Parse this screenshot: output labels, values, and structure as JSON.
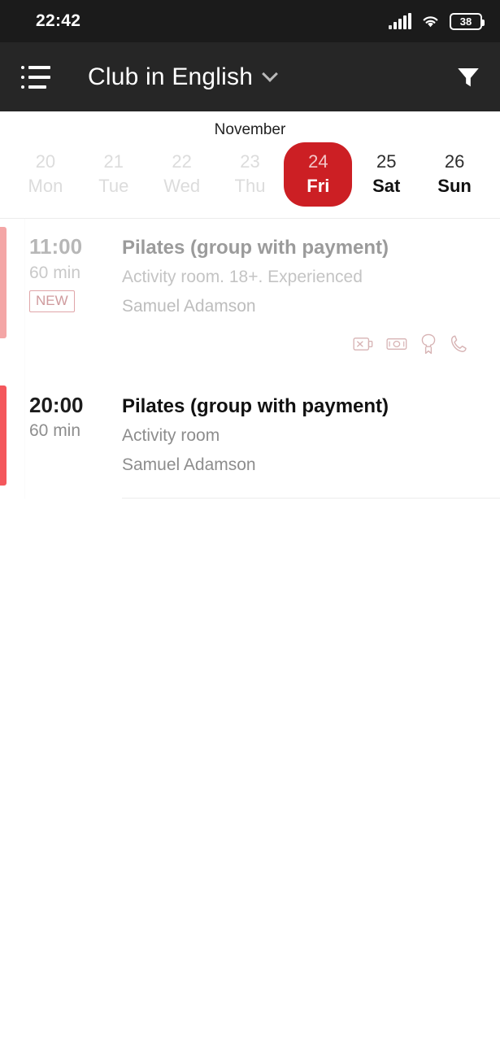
{
  "statusbar": {
    "time": "22:42",
    "signal_icon": "cellular-signal-icon",
    "wifi_icon": "wifi-icon",
    "battery_icon": "battery-icon",
    "battery_level": "38"
  },
  "appbar": {
    "menu_icon": "list-menu-icon",
    "title": "Club in English",
    "dropdown_icon": "chevron-down-icon",
    "filter_icon": "filter-funnel-icon"
  },
  "calendar": {
    "month": "November",
    "days": [
      {
        "num": "20",
        "dow": "Mon",
        "state": "past"
      },
      {
        "num": "21",
        "dow": "Tue",
        "state": "past"
      },
      {
        "num": "22",
        "dow": "Wed",
        "state": "past"
      },
      {
        "num": "23",
        "dow": "Thu",
        "state": "past"
      },
      {
        "num": "24",
        "dow": "Fri",
        "state": "selected"
      },
      {
        "num": "25",
        "dow": "Sat",
        "state": "normal"
      },
      {
        "num": "26",
        "dow": "Sun",
        "state": "normal"
      }
    ],
    "selected_color": "#cc1f24"
  },
  "events": [
    {
      "time": "11:00",
      "duration": "60 min",
      "badge": "NEW",
      "title": "Pilates (group with payment)",
      "subtitle": "Activity room. 18+. Experienced",
      "coach": "Samuel Adamson",
      "accent_color": "#f4a6a6",
      "icons": [
        "no-card-payment-icon",
        "cash-banknote-icon",
        "award-medal-icon",
        "phone-call-icon"
      ]
    },
    {
      "time": "20:00",
      "duration": "60 min",
      "badge": "",
      "title": "Pilates (group with payment)",
      "subtitle": "Activity room",
      "coach": "Samuel Adamson",
      "accent_color": "#f4575c",
      "icons": []
    }
  ]
}
